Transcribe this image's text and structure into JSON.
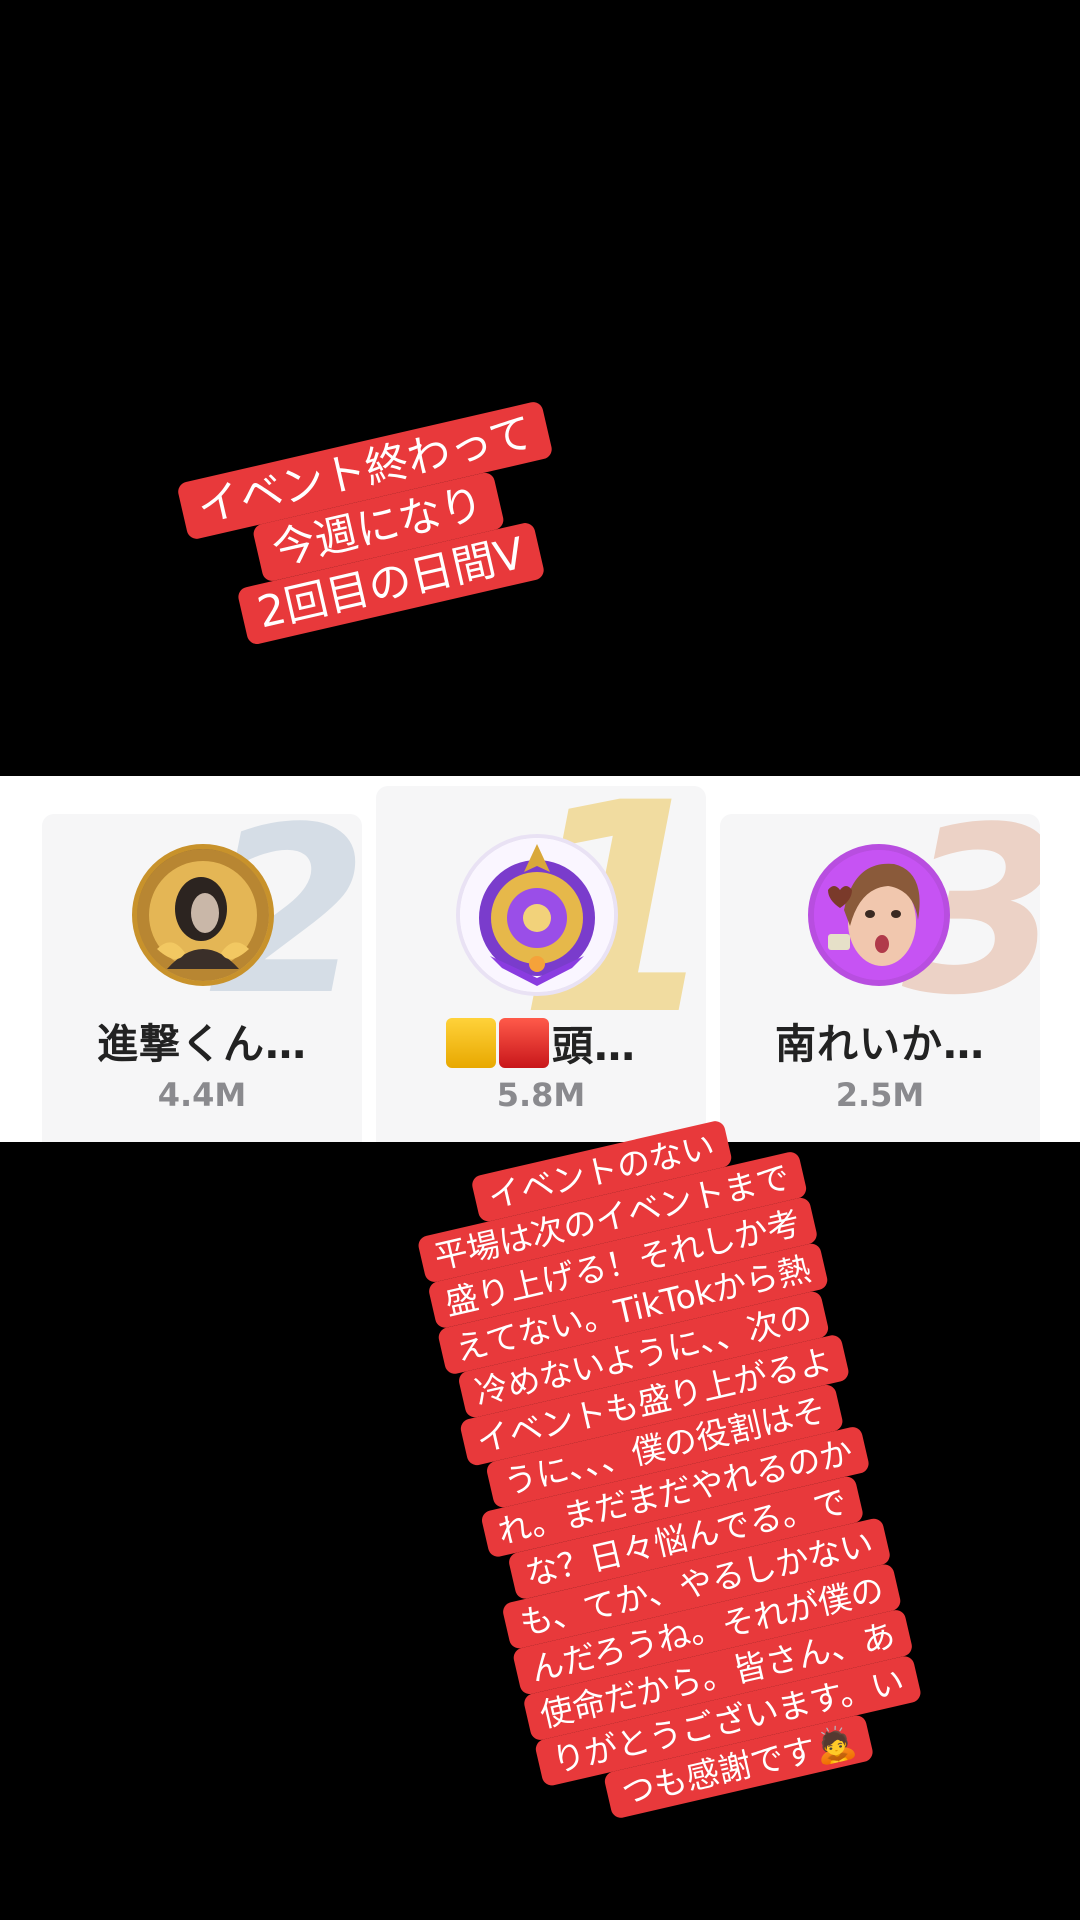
{
  "caption_top": {
    "lines": [
      "イベント終わって",
      "今週になり",
      "2回目の日間V"
    ]
  },
  "leaderboard": {
    "entries": [
      {
        "rank": "2",
        "name": "進撃くん…",
        "score": "4.4M",
        "avatar": "anime-character-gold-frame-avatar"
      },
      {
        "rank": "1",
        "name": "頭…",
        "name_prefix_icons": [
          "yellow-square-emoji",
          "red-square-emoji"
        ],
        "score": "5.8M",
        "avatar": "purple-gold-emblem-avatar"
      },
      {
        "rank": "3",
        "name": "南れいか…",
        "score": "2.5M",
        "avatar": "woman-surprised-face-avatar"
      }
    ],
    "colors": {
      "rank_1": "#f1dca0",
      "rank_2": "#d5dde6",
      "rank_3": "#ecd2c6"
    }
  },
  "caption_bottom": {
    "lines": [
      "イベントのない",
      "平場は次のイベントまで",
      "盛り上げる！それしか考",
      "えてない。TikTokから熱",
      "冷めないように、、次の",
      "イベントも盛り上がるよ",
      "うに、、、僕の役割はそ",
      "れ。まだまだやれるのか",
      "な？日々悩んでる。で",
      "も、てか、やるしかない",
      "んだろうね。それが僕の",
      "使命だから。皆さん、あ",
      "りがとうございます。い",
      "つも感謝です🙇"
    ]
  },
  "colors": {
    "sticker_bg": "#e8393b",
    "background": "#000000"
  }
}
